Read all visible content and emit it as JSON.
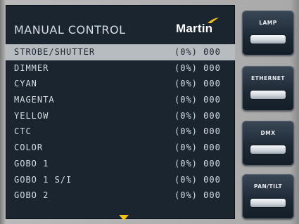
{
  "title": "MANUAL CONTROL",
  "brand": "Martin",
  "rows": [
    {
      "label": "STROBE/SHUTTER",
      "value": "(0%) 000",
      "selected": true
    },
    {
      "label": "DIMMER",
      "value": "(0%) 000"
    },
    {
      "label": "CYAN",
      "value": "(0%) 000"
    },
    {
      "label": "MAGENTA",
      "value": "(0%) 000"
    },
    {
      "label": "YELLOW",
      "value": "(0%) 000"
    },
    {
      "label": "CTC",
      "value": "(0%) 000"
    },
    {
      "label": "COLOR",
      "value": "(0%) 000"
    },
    {
      "label": "GOBO 1",
      "value": "(0%) 000"
    },
    {
      "label": "GOBO 1 S/I",
      "value": "(0%) 000"
    },
    {
      "label": "GOBO 2",
      "value": "(0%) 000"
    }
  ],
  "side_buttons": [
    {
      "label": "LAMP"
    },
    {
      "label": "ETHERNET"
    },
    {
      "label": "DMX"
    },
    {
      "label": "PAN/TILT"
    }
  ],
  "colors": {
    "screen_bg": "#1a2530",
    "highlight": "#b7bcc1",
    "arrow": "#f2c21b",
    "logo_accent": "#f2c21b"
  },
  "icons": {
    "scroll_down": "scroll-down-arrow-icon",
    "logo_mark": "martin-swoosh-icon"
  }
}
